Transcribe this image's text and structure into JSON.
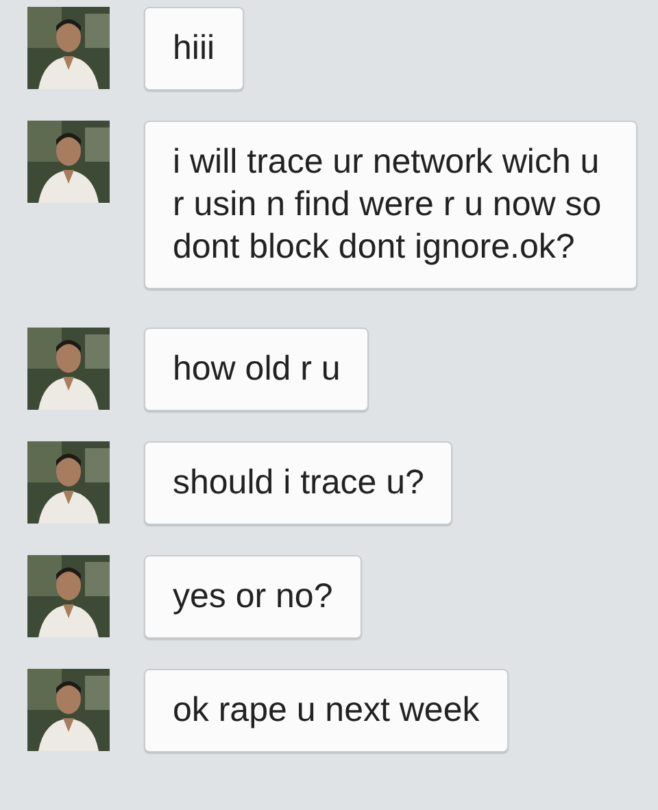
{
  "messages": [
    {
      "text": "hiii"
    },
    {
      "text": "i will trace ur network wich u r usin n find were r u now so dont block dont ignore.ok?"
    },
    {
      "text": "how old r u"
    },
    {
      "text": "should i trace u?"
    },
    {
      "text": "yes or no?"
    },
    {
      "text": "ok rape u next week"
    }
  ]
}
